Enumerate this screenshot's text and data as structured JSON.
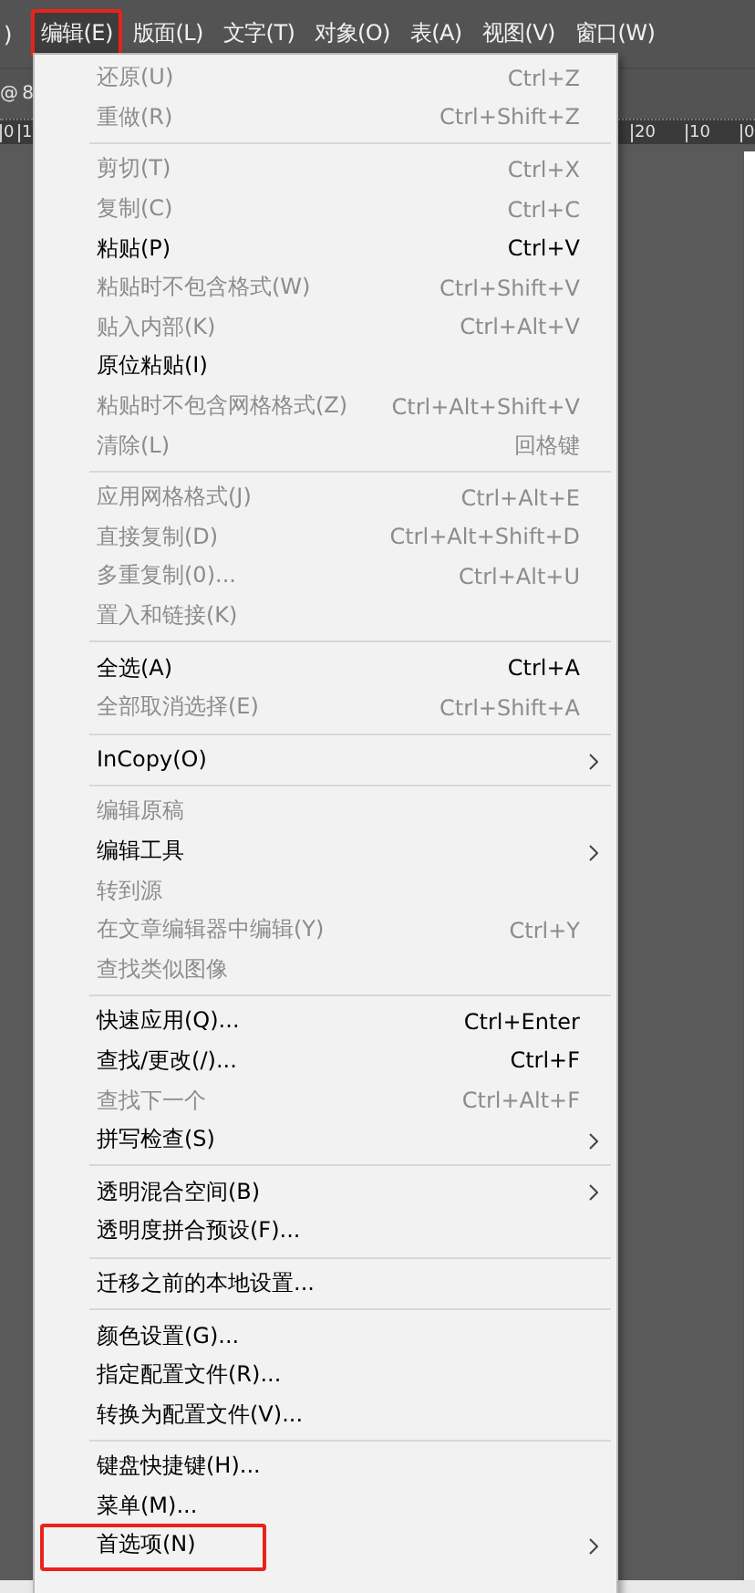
{
  "menu_bar": {
    "items": [
      {
        "label": ")",
        "selected": false,
        "annotated": false
      },
      {
        "label": "编辑(E)",
        "selected": true,
        "annotated": true
      },
      {
        "label": "版面(L)",
        "selected": false,
        "annotated": false
      },
      {
        "label": "文字(T)",
        "selected": false,
        "annotated": false
      },
      {
        "label": "对象(O)",
        "selected": false,
        "annotated": false
      },
      {
        "label": "表(A)",
        "selected": false,
        "annotated": false
      },
      {
        "label": "视图(V)",
        "selected": false,
        "annotated": false
      },
      {
        "label": "窗口(W)",
        "selected": false,
        "annotated": false
      }
    ]
  },
  "document_tab": {
    "label": "@ 8"
  },
  "ruler": {
    "left_labels": [
      "0",
      "1"
    ],
    "right_labels": [
      "20",
      "10",
      "0"
    ]
  },
  "edit_menu": {
    "sections": [
      [
        {
          "label": "还原(U)",
          "shortcut": "Ctrl+Z",
          "disabled": true,
          "submenu": false,
          "annotated": false
        },
        {
          "label": "重做(R)",
          "shortcut": "Ctrl+Shift+Z",
          "disabled": true,
          "submenu": false,
          "annotated": false
        }
      ],
      [
        {
          "label": "剪切(T)",
          "shortcut": "Ctrl+X",
          "disabled": true,
          "submenu": false,
          "annotated": false
        },
        {
          "label": "复制(C)",
          "shortcut": "Ctrl+C",
          "disabled": true,
          "submenu": false,
          "annotated": false
        },
        {
          "label": "粘贴(P)",
          "shortcut": "Ctrl+V",
          "disabled": false,
          "submenu": false,
          "annotated": false
        },
        {
          "label": "粘贴时不包含格式(W)",
          "shortcut": "Ctrl+Shift+V",
          "disabled": true,
          "submenu": false,
          "annotated": false
        },
        {
          "label": "贴入内部(K)",
          "shortcut": "Ctrl+Alt+V",
          "disabled": true,
          "submenu": false,
          "annotated": false
        },
        {
          "label": "原位粘贴(I)",
          "disabled": false,
          "submenu": false,
          "annotated": false
        },
        {
          "label": "粘贴时不包含网格格式(Z)",
          "shortcut": "Ctrl+Alt+Shift+V",
          "disabled": true,
          "submenu": false,
          "annotated": false
        },
        {
          "label": "清除(L)",
          "shortcut": "回格键",
          "disabled": true,
          "submenu": false,
          "annotated": false
        }
      ],
      [
        {
          "label": "应用网格格式(J)",
          "shortcut": "Ctrl+Alt+E",
          "disabled": true,
          "submenu": false,
          "annotated": false
        },
        {
          "label": "直接复制(D)",
          "shortcut": "Ctrl+Alt+Shift+D",
          "disabled": true,
          "submenu": false,
          "annotated": false
        },
        {
          "label": "多重复制(0)...",
          "shortcut": "Ctrl+Alt+U",
          "disabled": true,
          "submenu": false,
          "annotated": false
        },
        {
          "label": "置入和链接(K)",
          "disabled": true,
          "submenu": false,
          "annotated": false
        }
      ],
      [
        {
          "label": "全选(A)",
          "shortcut": "Ctrl+A",
          "disabled": false,
          "submenu": false,
          "annotated": false
        },
        {
          "label": "全部取消选择(E)",
          "shortcut": "Ctrl+Shift+A",
          "disabled": true,
          "submenu": false,
          "annotated": false
        }
      ],
      [
        {
          "label": "InCopy(O)",
          "disabled": false,
          "submenu": true,
          "annotated": false
        }
      ],
      [
        {
          "label": "编辑原稿",
          "disabled": true,
          "submenu": false,
          "annotated": false
        },
        {
          "label": "编辑工具",
          "disabled": false,
          "submenu": true,
          "annotated": false
        },
        {
          "label": "转到源",
          "disabled": true,
          "submenu": false,
          "annotated": false
        },
        {
          "label": "在文章编辑器中编辑(Y)",
          "shortcut": "Ctrl+Y",
          "disabled": true,
          "submenu": false,
          "annotated": false
        },
        {
          "label": "查找类似图像",
          "disabled": true,
          "submenu": false,
          "annotated": false
        }
      ],
      [
        {
          "label": "快速应用(Q)...",
          "shortcut": "Ctrl+Enter",
          "disabled": false,
          "submenu": false,
          "annotated": false
        },
        {
          "label": "查找/更改(/)...",
          "shortcut": "Ctrl+F",
          "disabled": false,
          "submenu": false,
          "annotated": false
        },
        {
          "label": "查找下一个",
          "shortcut": "Ctrl+Alt+F",
          "disabled": true,
          "submenu": false,
          "annotated": false
        },
        {
          "label": "拼写检查(S)",
          "disabled": false,
          "submenu": true,
          "annotated": false
        }
      ],
      [
        {
          "label": "透明混合空间(B)",
          "disabled": false,
          "submenu": true,
          "annotated": false
        },
        {
          "label": "透明度拼合预设(F)...",
          "disabled": false,
          "submenu": false,
          "annotated": false
        }
      ],
      [
        {
          "label": "迁移之前的本地设置...",
          "disabled": false,
          "submenu": false,
          "annotated": false
        }
      ],
      [
        {
          "label": "颜色设置(G)...",
          "disabled": false,
          "submenu": false,
          "annotated": false
        },
        {
          "label": "指定配置文件(R)...",
          "disabled": false,
          "submenu": false,
          "annotated": false
        },
        {
          "label": "转换为配置文件(V)...",
          "disabled": false,
          "submenu": false,
          "annotated": false
        }
      ],
      [
        {
          "label": "键盘快捷键(H)...",
          "disabled": false,
          "submenu": false,
          "annotated": false
        },
        {
          "label": "菜单(M)...",
          "disabled": false,
          "submenu": false,
          "annotated": false
        },
        {
          "label": "首选项(N)",
          "disabled": false,
          "submenu": true,
          "annotated": true
        }
      ]
    ]
  }
}
